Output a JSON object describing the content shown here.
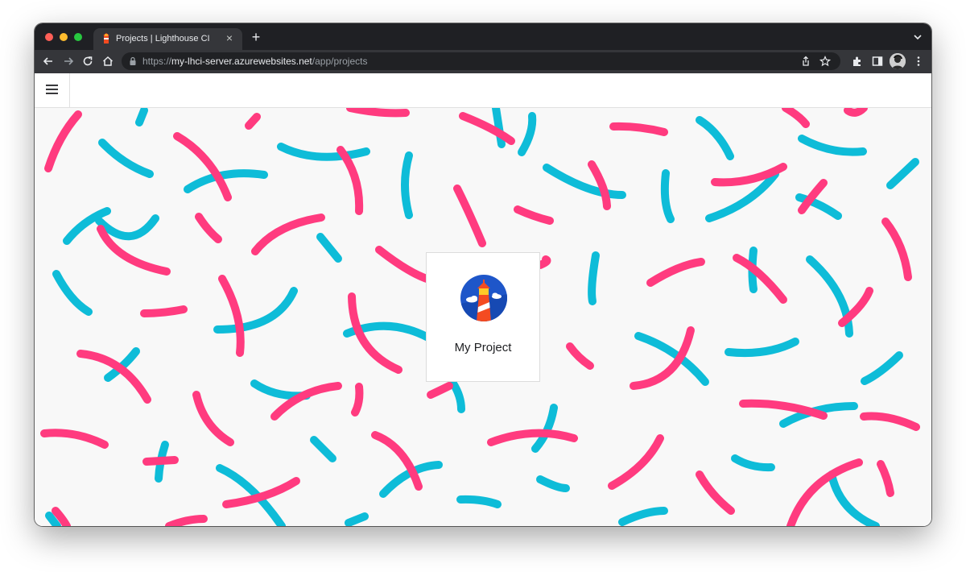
{
  "browser": {
    "tab": {
      "title": "Projects | Lighthouse CI",
      "close_glyph": "×",
      "favicon": "lighthouse-icon"
    },
    "new_tab_glyph": "+",
    "address_bar": {
      "scheme": "https://",
      "host": "my-lhci-server.azurewebsites.net",
      "path": "/app/projects"
    },
    "icons": [
      "back-icon",
      "forward-icon",
      "reload-icon",
      "home-icon",
      "lock-icon",
      "share-icon",
      "bookmark-star-icon",
      "extensions-icon",
      "side-panel-icon",
      "profile-avatar",
      "more-menu-icon",
      "tab-search-icon"
    ]
  },
  "app": {
    "header": {
      "menu_icon": "hamburger-menu-icon"
    },
    "projects": [
      {
        "name": "My Project",
        "logo": "lighthouse-logo-icon"
      }
    ]
  },
  "colors": {
    "pattern_pink": "#ff3b7f",
    "pattern_cyan": "#0ebcd8",
    "background": "#f8f8f8",
    "chrome_dark": "#1f2024",
    "chrome_toolbar": "#35363a"
  }
}
